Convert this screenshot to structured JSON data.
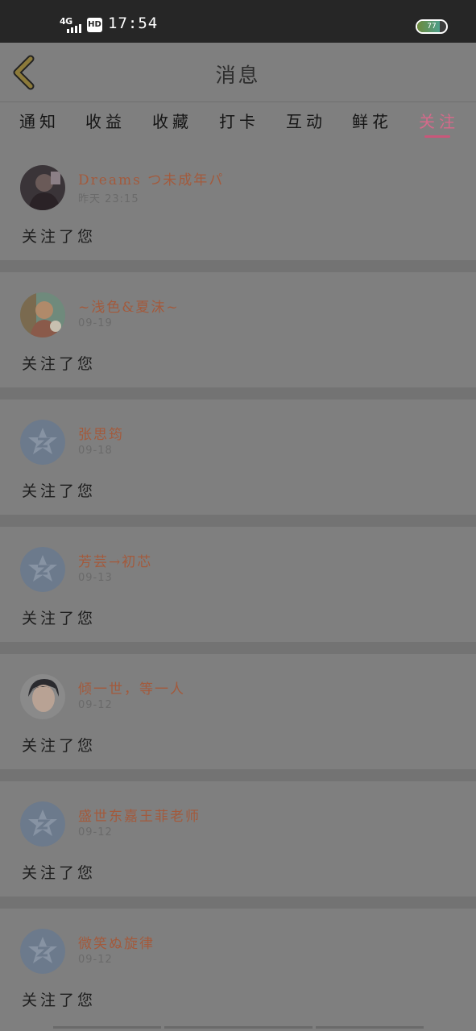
{
  "status_bar": {
    "network": "4G",
    "hd": "HD",
    "time": "17:54",
    "battery": "77",
    "battery_level": 0.77
  },
  "header": {
    "title": "消息",
    "back_icon": "chevron-left-icon"
  },
  "tabs": [
    {
      "label": "通知",
      "active": false
    },
    {
      "label": "收益",
      "active": false
    },
    {
      "label": "收藏",
      "active": false
    },
    {
      "label": "打卡",
      "active": false
    },
    {
      "label": "互动",
      "active": false
    },
    {
      "label": "鲜花",
      "active": false
    },
    {
      "label": "关注",
      "active": true
    }
  ],
  "notifications": [
    {
      "name": "Dreams つ未成年パ",
      "time": "昨天 23:15",
      "message": "关注了您",
      "avatar": "photo-dark"
    },
    {
      "name": "~浅色&夏沫~",
      "time": "09-19",
      "message": "关注了您",
      "avatar": "photo-child"
    },
    {
      "name": "张思筠",
      "time": "09-18",
      "message": "关注了您",
      "avatar": "default"
    },
    {
      "name": "芳芸→初芯",
      "time": "09-13",
      "message": "关注了您",
      "avatar": "default"
    },
    {
      "name": "倾一世，等一人",
      "time": "09-12",
      "message": "关注了您",
      "avatar": "photo-boy"
    },
    {
      "name": "盛世东嘉王菲老师",
      "time": "09-12",
      "message": "关注了您",
      "avatar": "default"
    },
    {
      "name": "微笑ぬ旋律",
      "time": "09-12",
      "message": "关注了您",
      "avatar": "default"
    }
  ],
  "colors": {
    "accent": "#c9577a",
    "name": "#a35a3c",
    "background": "#7f7f7f",
    "statusbar": "#262626"
  }
}
